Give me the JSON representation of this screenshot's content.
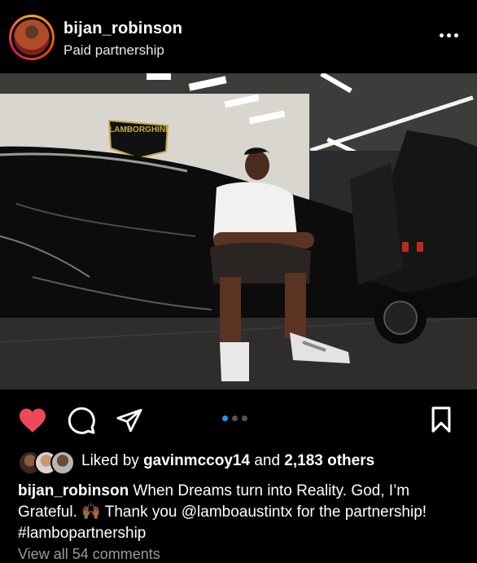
{
  "post": {
    "username": "bijan_robinson",
    "subtitle": "Paid partnership",
    "carousel": {
      "count": 3,
      "active_index": 0
    },
    "liked": true,
    "likes": {
      "prefix": "Liked by",
      "first_user": "gavinmccoy14",
      "connector": "and",
      "others": "2,183 others"
    },
    "caption": {
      "author": "bijan_robinson",
      "text_1": "When Dreams turn into Reality. God, I’m Grateful. ",
      "emoji": "🙌🏾",
      "text_2": " Thank you ",
      "mention": "@lamboaustintx",
      "text_3": " for the partnership! ",
      "hashtag": "#lambopartnership"
    },
    "comments_link": "View all 54 comments",
    "photo_sign": "LAMBORGHINI"
  },
  "icons": {
    "more": "more-horizontal-icon",
    "like": "heart-icon",
    "comment": "comment-icon",
    "share": "send-icon",
    "save": "bookmark-icon"
  },
  "colors": {
    "background": "#000000",
    "heart": "#ed4956",
    "carousel_active": "#1d9bf0",
    "text": "#ffffff"
  }
}
